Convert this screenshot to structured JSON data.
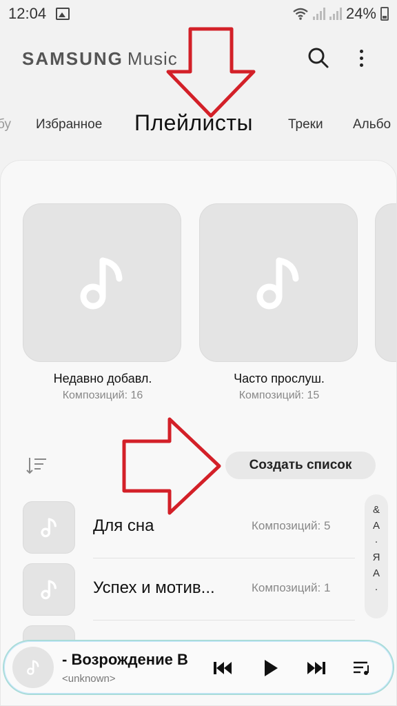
{
  "status": {
    "time": "12:04",
    "battery": "24%"
  },
  "header": {
    "brand_bold": "SAMSUNG",
    "brand_light": "Music"
  },
  "tabs": [
    {
      "label": "бу"
    },
    {
      "label": "Избранное"
    },
    {
      "label": "Плейлисты"
    },
    {
      "label": "Треки"
    },
    {
      "label": "Альбо"
    }
  ],
  "featured": [
    {
      "name": "Недавно добавл.",
      "count": "Композиций: 16"
    },
    {
      "name": "Часто прослуш.",
      "count": "Композиций: 15"
    }
  ],
  "create_button": "Создать список",
  "playlists": [
    {
      "title": "Для сна",
      "count": "Композиций: 5"
    },
    {
      "title": "Успех и мотив...",
      "count": "Композиций: 1"
    }
  ],
  "index_letters": [
    "&",
    "А",
    "·",
    "Я",
    "A",
    "·"
  ],
  "player": {
    "title": "- Возрождение В",
    "artist": "<unknown>"
  },
  "colors": {
    "accent_arrow": "#d32028",
    "player_border": "#a9dcd9"
  }
}
